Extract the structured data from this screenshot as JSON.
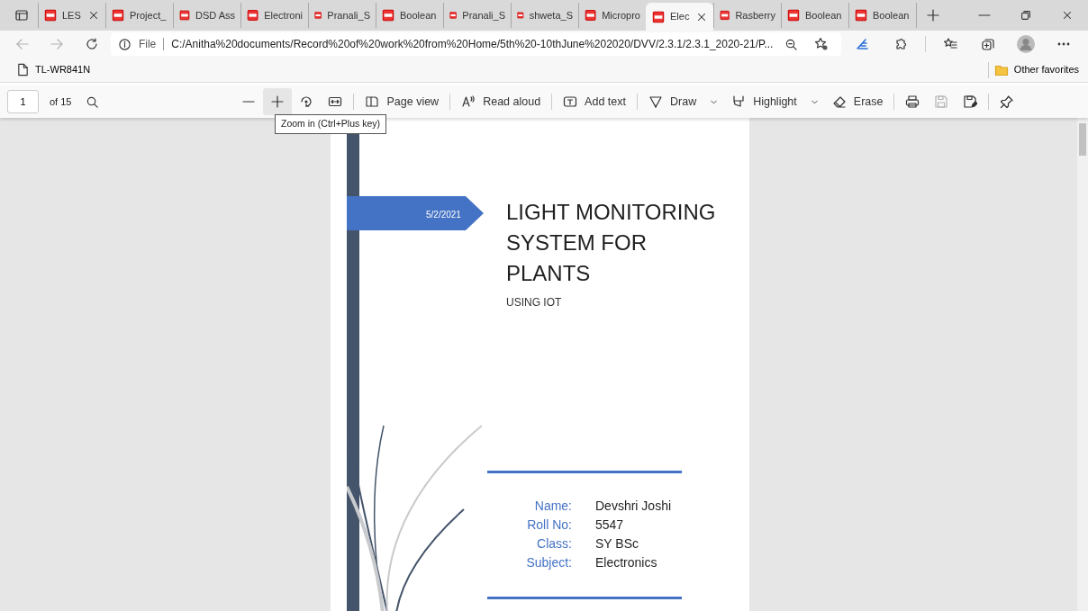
{
  "tabs": [
    {
      "label": "LES",
      "selected": false,
      "close_visible": true
    },
    {
      "label": "Project_",
      "selected": false,
      "close_visible": false
    },
    {
      "label": "DSD Ass",
      "selected": false,
      "close_visible": false
    },
    {
      "label": "Electroni",
      "selected": false,
      "close_visible": false
    },
    {
      "label": "Pranali_S",
      "selected": false,
      "close_visible": false
    },
    {
      "label": "Boolean",
      "selected": false,
      "close_visible": false
    },
    {
      "label": "Pranali_S",
      "selected": false,
      "close_visible": false
    },
    {
      "label": "shweta_S",
      "selected": false,
      "close_visible": false
    },
    {
      "label": "Micropro",
      "selected": false,
      "close_visible": false
    },
    {
      "label": "Elec",
      "selected": true,
      "close_visible": true
    },
    {
      "label": "Rasberry",
      "selected": false,
      "close_visible": false
    },
    {
      "label": "Boolean",
      "selected": false,
      "close_visible": false
    },
    {
      "label": "Boolean",
      "selected": false,
      "close_visible": false
    }
  ],
  "address_bar": {
    "scheme_label": "File",
    "url": "C:/Anitha%20documents/Record%20of%20work%20from%20Home/5th%20-10thJune%202020/DVV/2.3.1/2.3.1_2020-21/P..."
  },
  "favorites_bar": {
    "items": [
      {
        "label": "TL-WR841N"
      }
    ],
    "other_favorites": "Other favorites"
  },
  "pdf_toolbar": {
    "page_number": "1",
    "page_count": "of 15",
    "tool_groups": [
      [
        {
          "kind": "zoom-out",
          "hovered": false,
          "disabled": false
        },
        {
          "kind": "zoom-in",
          "hovered": true,
          "disabled": false
        },
        {
          "kind": "rotate",
          "hovered": false,
          "disabled": false
        },
        {
          "kind": "fit-width",
          "hovered": false,
          "disabled": false
        }
      ],
      [
        {
          "kind": "page-view",
          "label": "Page view",
          "hovered": false,
          "disabled": false
        }
      ],
      [
        {
          "kind": "read-aloud",
          "label": "Read aloud",
          "hovered": false,
          "disabled": false
        }
      ],
      [
        {
          "kind": "add-text",
          "label": "Add text",
          "hovered": false,
          "disabled": false
        }
      ],
      [
        {
          "kind": "draw",
          "label": "Draw",
          "dropdown": true,
          "hovered": false,
          "disabled": false
        },
        {
          "kind": "highlight",
          "label": "Highlight",
          "dropdown": true,
          "hovered": false,
          "disabled": false
        },
        {
          "kind": "erase",
          "label": "Erase",
          "hovered": false,
          "disabled": false
        }
      ],
      [
        {
          "kind": "print",
          "hovered": false,
          "disabled": false
        },
        {
          "kind": "save",
          "hovered": false,
          "disabled": true
        },
        {
          "kind": "save-as",
          "hovered": false,
          "disabled": false
        }
      ],
      [
        {
          "kind": "pin",
          "hovered": false,
          "disabled": false
        }
      ]
    ],
    "tooltip": "Zoom in (Ctrl+Plus key)"
  },
  "document": {
    "date": "5/2/2021",
    "title_lines": [
      "LIGHT MONITORING",
      "SYSTEM FOR",
      "PLANTS"
    ],
    "subtitle": "USING IOT",
    "details": [
      {
        "label": "Name:",
        "value": "Devshri Joshi"
      },
      {
        "label": "Roll No:",
        "value": "5547"
      },
      {
        "label": "Class:",
        "value": "SY BSc"
      },
      {
        "label": "Subject:",
        "value": "Electronics"
      }
    ]
  }
}
